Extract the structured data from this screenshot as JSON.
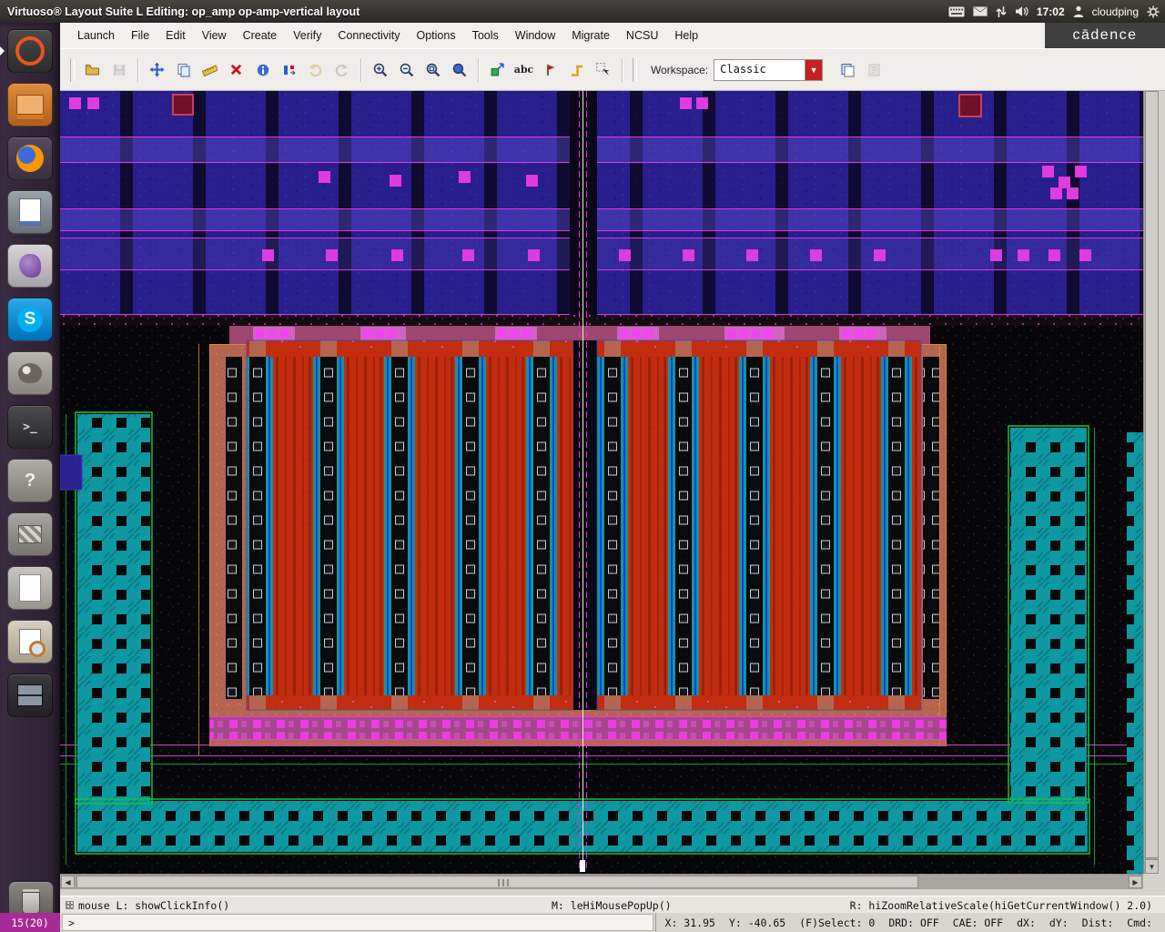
{
  "topbar": {
    "title": "Virtuoso® Layout Suite L Editing: op_amp op-amp-vertical layout",
    "time": "17:02",
    "user": "cloudping",
    "tray_icons": [
      "keyboard-icon",
      "mail-icon",
      "sync-arrows-icon",
      "volume-icon",
      "user-icon",
      "gear-icon"
    ]
  },
  "launcher": {
    "items": [
      "ubuntu-dash",
      "files",
      "firefox",
      "document-viewer",
      "pidgin",
      "skype",
      "gimp",
      "terminal",
      "help",
      "archive-tool",
      "text-file",
      "screenshot-tool",
      "workspace-switcher",
      "trash"
    ]
  },
  "menubar": {
    "items": [
      "Launch",
      "File",
      "Edit",
      "View",
      "Create",
      "Verify",
      "Connectivity",
      "Options",
      "Tools",
      "Window",
      "Migrate",
      "NCSU",
      "Help"
    ],
    "logo": "cādence"
  },
  "toolbar": {
    "buttons": [
      "open",
      "save",
      "stretch",
      "copy",
      "ruler",
      "delete",
      "properties",
      "rotate",
      "undo",
      "redo",
      "zoom-in-2x",
      "zoom-out-2x",
      "zoom-to-fit",
      "zoom-to-selected",
      "create-instance",
      "create-label",
      "create-pin",
      "create-wire",
      "select-mode",
      "copy-view",
      "paste-view"
    ],
    "abc_label": "abc",
    "workspace_label": "Workspace:",
    "workspace_value": "Classic"
  },
  "canvas": {
    "layer_colors": {
      "metal_purple": "#281e8c",
      "via_magenta": "#e03ae0",
      "poly_red": "#c22d10",
      "diffusion_cyan": "#0d96a0",
      "implant_salmon": "#b5654f",
      "well_green": "#15c23c",
      "pin_pink": "#a8458f"
    }
  },
  "statusbar": {
    "left": "mouse L: showClickInfo()",
    "middle": "M: leHiMousePopUp()",
    "right": "R: hiZoomRelativeScale(hiGetCurrentWindow() 2.0)"
  },
  "commandbar": {
    "count": "15(20)",
    "prompt": ">",
    "fields": [
      "X: 31.95",
      "Y: -40.65",
      "(F)Select: 0",
      "DRD: OFF",
      "CAE: OFF",
      "dX:",
      "dY:",
      "Dist:",
      "Cmd:"
    ]
  }
}
